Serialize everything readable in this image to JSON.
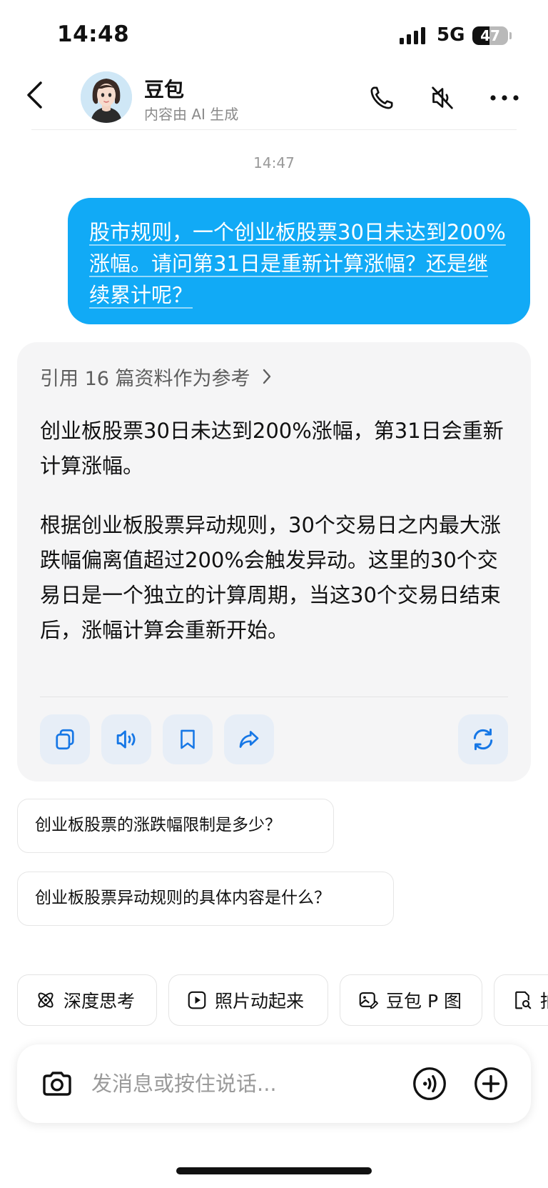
{
  "status_bar": {
    "time": "14:48",
    "network": "5G",
    "battery": "47",
    "battery_level": 0.47
  },
  "header": {
    "name": "豆包",
    "subtitle": "内容由 AI 生成"
  },
  "conversation": {
    "timestamp": "14:47",
    "user_message": "股市规则，一个创业板股票30日未达到200%涨幅。请问第31日是重新计算涨幅？还是继续累计呢？",
    "reference_label": "引用 16 篇资料作为参考",
    "ai_paragraphs": [
      "创业板股票30日未达到200%涨幅，第31日会重新计算涨幅。",
      "根据创业板股票异动规则，30个交易日之内最大涨跌幅偏离值超过200%会触发异动。这里的30个交易日是一个独立的计算周期，当这30个交易日结束后，涨幅计算会重新开始。"
    ],
    "actions": [
      "copy-icon",
      "speaker-icon",
      "bookmark-icon",
      "share-icon",
      "refresh-icon"
    ]
  },
  "suggestions": [
    "创业板股票的涨跌幅限制是多少？",
    "创业板股票异动规则的具体内容是什么？"
  ],
  "chips": [
    {
      "label": "深度思考",
      "icon": "atom-icon"
    },
    {
      "label": "照片动起来",
      "icon": "play-icon"
    },
    {
      "label": "豆包 P 图",
      "icon": "image-edit-icon"
    },
    {
      "label": "拍",
      "icon": "doc-search-icon"
    }
  ],
  "input": {
    "placeholder": "发消息或按住说话..."
  },
  "colors": {
    "accent": "#11aaf6",
    "card_bg": "#f5f5f6",
    "action_bg": "#e7eef7",
    "action_icon": "#1677e6"
  }
}
